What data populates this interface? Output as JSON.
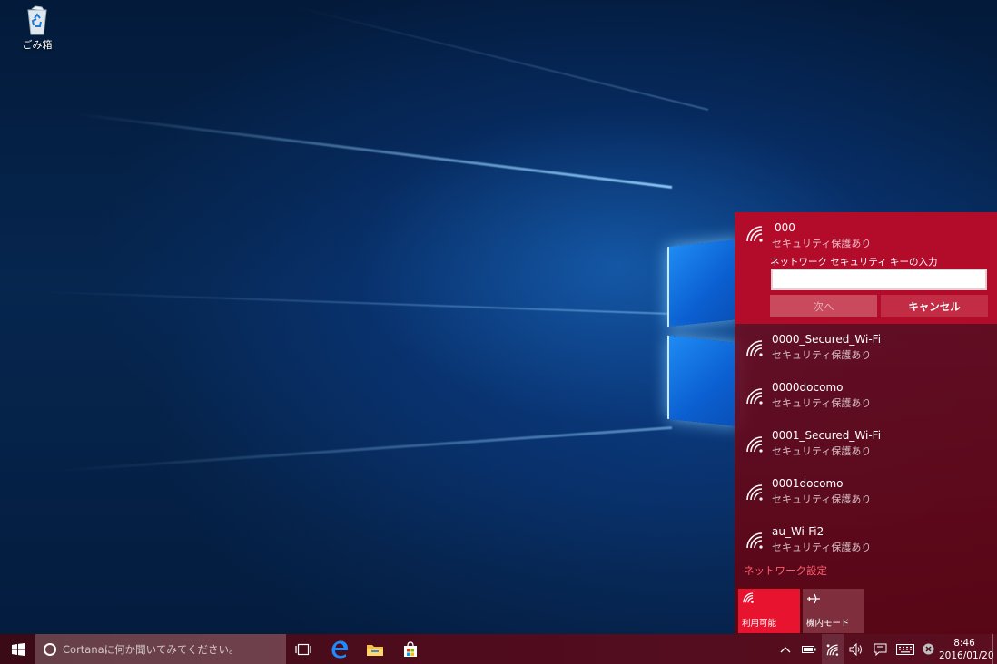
{
  "desktop": {
    "icons": [
      {
        "label": "ごみ箱",
        "icon": "recycle-bin-icon"
      }
    ]
  },
  "network_flyout": {
    "selected": {
      "ssid": "000",
      "status": "セキュリティ保護あり",
      "key_label": "ネットワーク セキュリティ キーの入力",
      "key_value": "",
      "next_label": "次へ",
      "cancel_label": "キャンセル"
    },
    "networks": [
      {
        "ssid": "0000_Secured_Wi-Fi",
        "status": "セキュリティ保護あり"
      },
      {
        "ssid": "0000docomo",
        "status": "セキュリティ保護あり"
      },
      {
        "ssid": "0001_Secured_Wi-Fi",
        "status": "セキュリティ保護あり"
      },
      {
        "ssid": "0001docomo",
        "status": "セキュリティ保護あり"
      },
      {
        "ssid": "au_Wi-Fi2",
        "status": "セキュリティ保護あり"
      }
    ],
    "settings_link": "ネットワーク設定",
    "quick_actions": [
      {
        "label": "利用可能",
        "icon": "wifi-icon",
        "active": true
      },
      {
        "label": "機内モード",
        "icon": "airplane-icon",
        "active": false
      }
    ],
    "colors": {
      "selected_bg": "#b30b2a",
      "link": "#ff5a6e",
      "tile_active": "#e8142f"
    }
  },
  "taskbar": {
    "search_placeholder": "Cortanaに何か聞いてみてください。",
    "pinned": [
      "task-view-icon",
      "edge-icon",
      "file-explorer-icon",
      "store-icon"
    ],
    "tray_icons": [
      "chevron-up-icon",
      "battery-icon",
      "network-icon",
      "volume-icon",
      "action-center-icon",
      "keyboard-icon",
      "close-circle-icon"
    ],
    "clock": {
      "time": "8:46",
      "date": "2016/01/20"
    }
  }
}
